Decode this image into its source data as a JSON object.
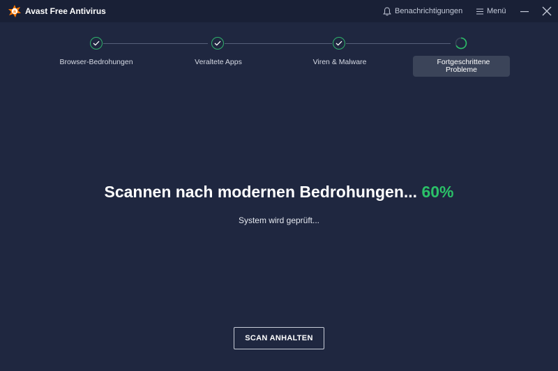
{
  "titlebar": {
    "app_title": "Avast Free Antivirus",
    "notifications_label": "Benachrichtigungen",
    "menu_label": "Menü",
    "icons": [
      "avast-logo-icon",
      "bell-icon",
      "hamburger-icon",
      "minimize-icon",
      "close-icon"
    ]
  },
  "steps": [
    {
      "label": "Browser-Bedrohungen",
      "status": "done"
    },
    {
      "label": "Veraltete Apps",
      "status": "done"
    },
    {
      "label": "Viren & Malware",
      "status": "done"
    },
    {
      "label": "Fortgeschrittene Probleme",
      "status": "active"
    }
  ],
  "scan": {
    "headline": "Scannen nach modernen Bedrohungen...",
    "percent": "60%",
    "status_text": "System wird geprüft...",
    "stop_button": "SCAN ANHALTEN"
  },
  "colors": {
    "background": "#1f2740",
    "titlebar": "#192036",
    "accent_green": "#2bc168",
    "brand_orange": "#ff7800"
  }
}
